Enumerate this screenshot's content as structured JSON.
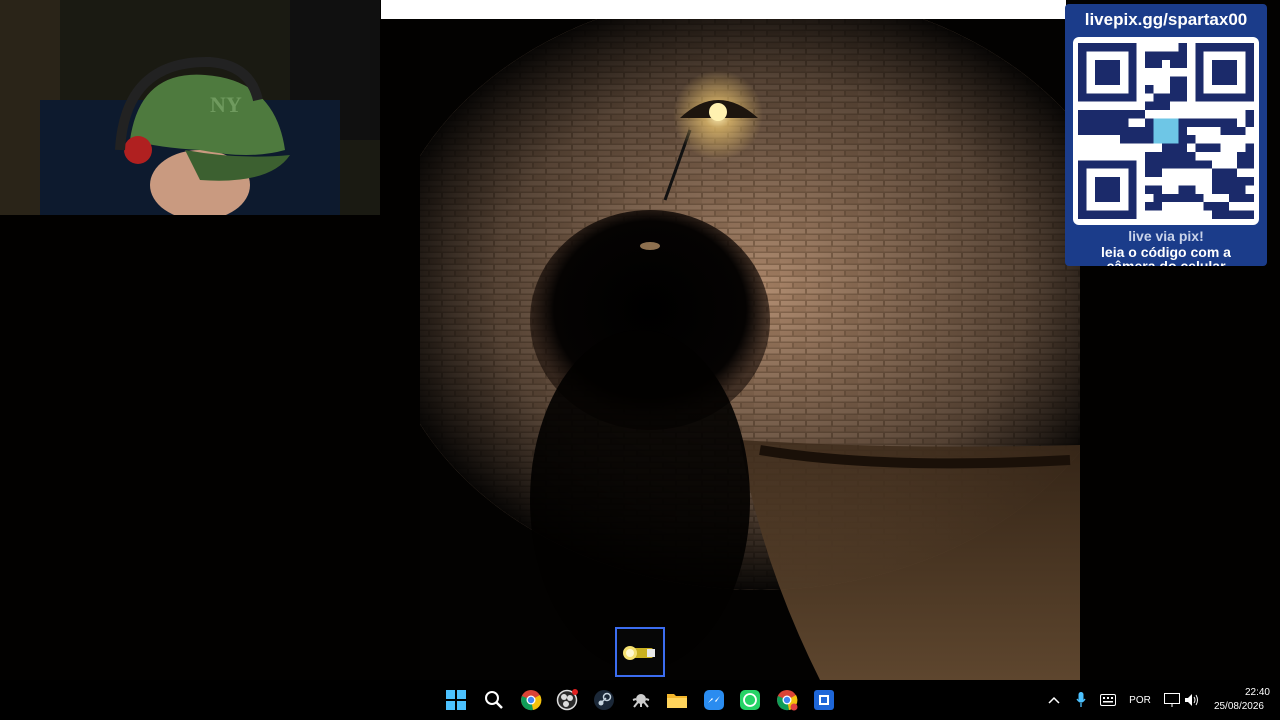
{
  "stream_overlay": {
    "qr_url": "livepix.gg/spartax00",
    "qr_line1": "live via pix!",
    "qr_line2": "leia o código com a",
    "qr_line3": "câmera do celular"
  },
  "taskbar": {
    "apps": [
      {
        "name": "start-icon"
      },
      {
        "name": "search-icon"
      },
      {
        "name": "chrome-icon"
      },
      {
        "name": "obs-icon"
      },
      {
        "name": "steam-icon"
      },
      {
        "name": "game-app-icon"
      },
      {
        "name": "file-explorer-icon"
      },
      {
        "name": "messenger-icon"
      },
      {
        "name": "whatsapp-icon"
      },
      {
        "name": "chrome-profile-icon"
      },
      {
        "name": "game-window-icon"
      }
    ],
    "language": "POR",
    "time": "22:40",
    "date": "25/08/2026"
  },
  "game": {
    "inventory_item": "flashlight-icon"
  },
  "colors": {
    "inventory_border": "#3c6df0",
    "overlay_bg": "#1b3c8a"
  }
}
